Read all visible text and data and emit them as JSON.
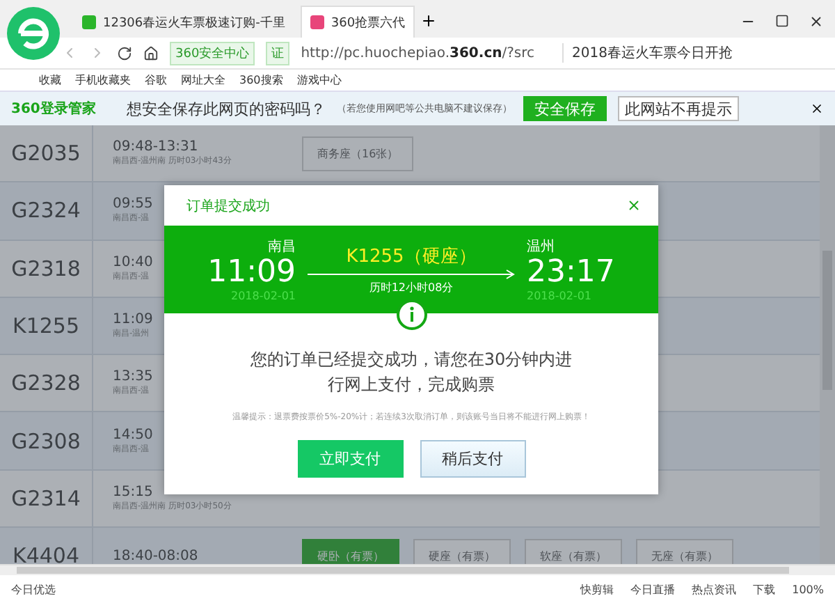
{
  "tabs": [
    {
      "label": "12306春运火车票极速订购-千里",
      "selected": false
    },
    {
      "label": "360抢票六代",
      "selected": true
    }
  ],
  "address_bar": {
    "badge": "360安全中心",
    "cert": "证",
    "url": "http://pc.huochepiao.**360.cn**/?src",
    "search": "2018春运火车票今日开抢"
  },
  "bookmarks": [
    "收藏",
    "手机收藏夹",
    "谷歌",
    "网址大全",
    "360搜索",
    "游戏中心"
  ],
  "password_bar": {
    "brand": "360登录管家",
    "question": "想安全保存此网页的密码吗？",
    "note": "（若您使用网吧等公共电脑不建议保存）",
    "save_button": "安全保存",
    "never_button": "此网站不再提示"
  },
  "trains": [
    {
      "number": "G2035",
      "time": "09:48-13:31",
      "detail": "南昌西-温州南 历时03小时43分",
      "seats": [
        {
          "label": "商务座（16张）",
          "selected": false
        }
      ]
    },
    {
      "number": "G2324",
      "time": "09:55",
      "detail": "南昌西-温"
    },
    {
      "number": "G2318",
      "time": "10:40",
      "detail": "南昌西-温"
    },
    {
      "number": "K1255",
      "time": "11:09",
      "detail": "南昌-温州"
    },
    {
      "number": "G2328",
      "time": "13:35",
      "detail": "南昌西-温"
    },
    {
      "number": "G2308",
      "time": "14:50",
      "detail": "南昌西-温"
    },
    {
      "number": "G2314",
      "time": "15:15",
      "detail": "南昌西-温州南 历时03小时50分"
    },
    {
      "number": "K4404",
      "time": "18:40-08:08",
      "seats": [
        {
          "label": "硬卧（有票）",
          "selected": true
        },
        {
          "label": "硬座（有票）",
          "selected": false
        },
        {
          "label": "软座（有票）",
          "selected": false
        },
        {
          "label": "无座（有票）",
          "selected": false
        }
      ]
    }
  ],
  "dialog": {
    "title": "订单提交成功",
    "from_city": "南昌",
    "from_time": "11:09",
    "from_date": "2018-02-01",
    "train": "K1255（硬座）",
    "duration": "历时12小时08分",
    "to_city": "温州",
    "to_time": "23:17",
    "to_date": "2018-02-01",
    "message": "您的订单已经提交成功，请您在30分钟内进行网上支付，完成购票",
    "tip": "温馨提示：退票费按票价5%-20%计；若连续3次取消订单，则该账号当日将不能进行网上购票！",
    "buttons": [
      {
        "label": "立即支付",
        "kind": "primary"
      },
      {
        "label": "稍后支付",
        "kind": "secondary"
      }
    ]
  },
  "status_bar": {
    "left": "今日优选",
    "items": [
      "快剪辑",
      "今日直播",
      "热点资讯",
      "下载"
    ],
    "zoom": "100%"
  }
}
